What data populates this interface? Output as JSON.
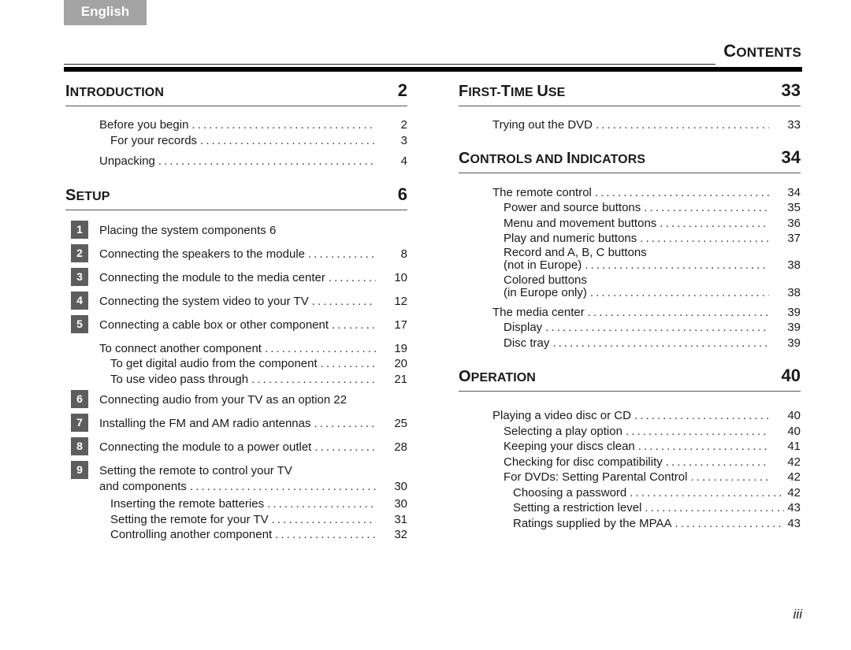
{
  "language_tab": "English",
  "page_title": {
    "first": "C",
    "rest": "ONTENTS"
  },
  "folio": "iii",
  "left": {
    "intro": {
      "title_first": "I",
      "title_rest": "NTRODUCTION",
      "page": "2",
      "entries": [
        {
          "label": "Before you begin",
          "page": "2"
        },
        {
          "label": "For your records",
          "page": "3"
        },
        {
          "label": "Unpacking",
          "page": "4"
        }
      ]
    },
    "setup": {
      "title_first": "S",
      "title_rest": "ETUP",
      "page": "6",
      "steps": [
        {
          "num": "1",
          "label": "Placing the system components 6",
          "page": ""
        },
        {
          "num": "2",
          "label": "Connecting the speakers to the module",
          "page": "8"
        },
        {
          "num": "3",
          "label": "Connecting the module to the media center",
          "page": "10"
        },
        {
          "num": "4",
          "label": "Connecting the system video to your TV",
          "page": "12"
        },
        {
          "num": "5",
          "label": "Connecting a cable box or other component",
          "page": "17"
        },
        {
          "num": "6",
          "label": "Connecting audio from your TV as an option 22",
          "page": ""
        },
        {
          "num": "7",
          "label": "Installing the FM and AM radio antennas",
          "page": "25"
        },
        {
          "num": "8",
          "label": "Connecting the module to a power outlet",
          "page": "28"
        },
        {
          "num": "9",
          "label": "Setting the remote to control your TV",
          "label2": "and components",
          "page": "30"
        }
      ],
      "sub5": [
        {
          "label": "To connect another component",
          "page": "19"
        },
        {
          "label": "To get digital audio from the component",
          "page": "20"
        },
        {
          "label": "To use video pass through",
          "page": "21"
        }
      ],
      "sub9": [
        {
          "label": "Inserting the remote batteries",
          "page": "30"
        },
        {
          "label": "Setting the remote for your TV",
          "page": "31"
        },
        {
          "label": "Controlling another component",
          "page": "32"
        }
      ]
    }
  },
  "right": {
    "first_time": {
      "title_a_first": "F",
      "title_a_rest": "IRST-",
      "title_b_first": "T",
      "title_b_rest": "IME ",
      "title_c_first": "U",
      "title_c_rest": "SE",
      "page": "33",
      "entries": [
        {
          "label": "Trying out the DVD",
          "page": "33"
        }
      ]
    },
    "controls": {
      "title_a_first": "C",
      "title_a_rest": "ONTROLS AND ",
      "title_b_first": "I",
      "title_b_rest": "NDICATORS",
      "page": "34",
      "entries": [
        {
          "label": "The remote control",
          "page": "34"
        },
        {
          "label": "Power and source buttons",
          "page": "35"
        },
        {
          "label": "Menu and movement buttons",
          "page": "36"
        },
        {
          "label": "Play and numeric buttons",
          "page": "37"
        },
        {
          "label": "Record and A, B, C buttons",
          "label2": "(not in Europe)",
          "page": "38"
        },
        {
          "label": "Colored buttons",
          "label2": "(in Europe only)",
          "page": "38"
        },
        {
          "label": "The media center",
          "page": "39"
        },
        {
          "label": "Display",
          "page": "39"
        },
        {
          "label": "Disc tray",
          "page": "39"
        }
      ]
    },
    "operation": {
      "title_first": "O",
      "title_rest": "PERATION",
      "page": "40",
      "entries": [
        {
          "label": "Playing a video disc or CD",
          "page": "40"
        },
        {
          "label": "Selecting a play option",
          "page": "40"
        },
        {
          "label": "Keeping your discs clean",
          "page": "41"
        },
        {
          "label": "Checking for disc compatibility",
          "page": "42"
        },
        {
          "label": "For DVDs: Setting Parental Control",
          "page": "42"
        },
        {
          "label": "Choosing a password",
          "page": "42"
        },
        {
          "label": "Setting a restriction level",
          "page": "43"
        },
        {
          "label": "Ratings supplied by the MPAA",
          "page": "43"
        }
      ]
    }
  }
}
